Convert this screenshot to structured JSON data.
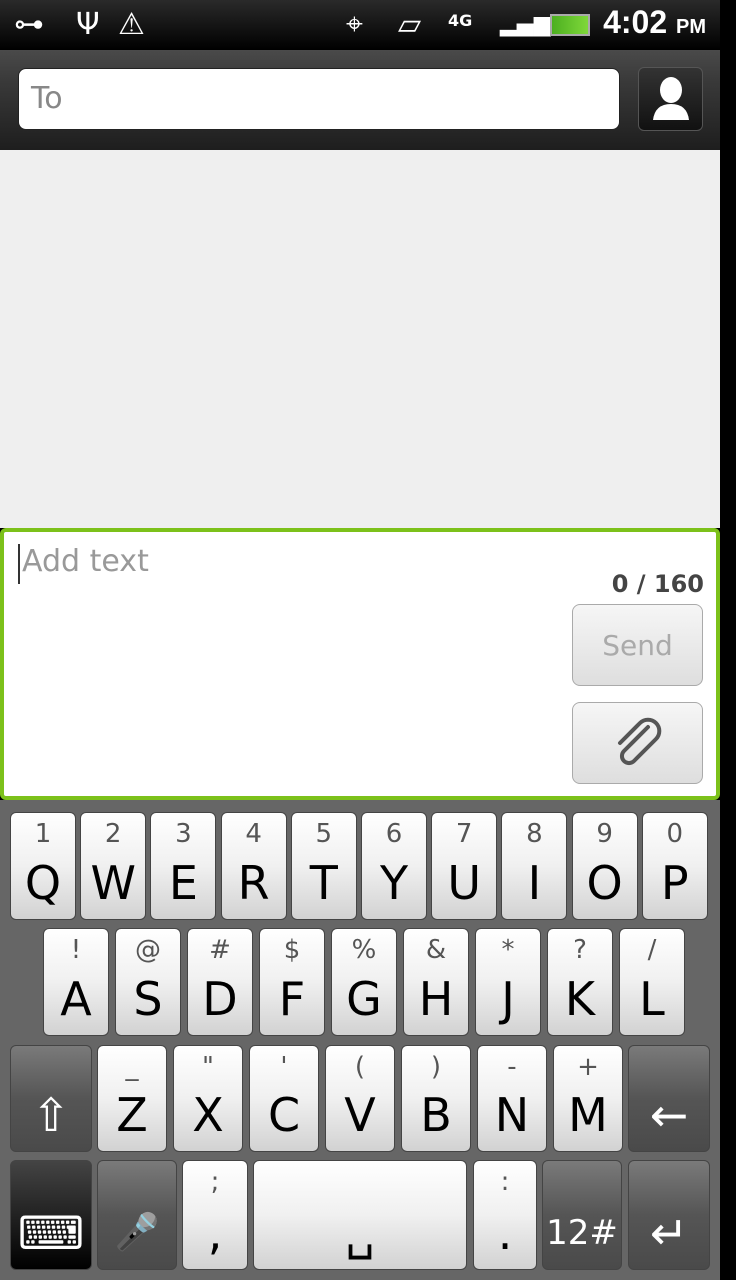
{
  "status_bar": {
    "icons": [
      "link-icon",
      "usb-icon",
      "warning-icon",
      "gps-icon",
      "vibrate-icon",
      "4g-lte-icon",
      "signal-icon",
      "battery-charging-icon"
    ],
    "network": "4G",
    "time": "4:02",
    "ampm": "PM"
  },
  "header": {
    "to_placeholder": "To",
    "contact_icon": "person-icon"
  },
  "compose": {
    "placeholder": "Add text",
    "counter": "0 / 160",
    "send_label": "Send",
    "attach_icon": "paperclip-icon",
    "accent": "#7cc11a"
  },
  "keyboard": {
    "row1": [
      [
        "1",
        "Q"
      ],
      [
        "2",
        "W"
      ],
      [
        "3",
        "E"
      ],
      [
        "4",
        "R"
      ],
      [
        "5",
        "T"
      ],
      [
        "6",
        "Y"
      ],
      [
        "7",
        "U"
      ],
      [
        "8",
        "I"
      ],
      [
        "9",
        "O"
      ],
      [
        "0",
        "P"
      ]
    ],
    "row2": [
      [
        "!",
        "A"
      ],
      [
        "@",
        "S"
      ],
      [
        "#",
        "D"
      ],
      [
        "$",
        "F"
      ],
      [
        "%",
        "G"
      ],
      [
        "&",
        "H"
      ],
      [
        "*",
        "J"
      ],
      [
        "?",
        "K"
      ],
      [
        "/",
        "L"
      ]
    ],
    "row3": [
      [
        "_",
        "Z"
      ],
      [
        "\"",
        "X"
      ],
      [
        "'",
        "C"
      ],
      [
        "(",
        "V"
      ],
      [
        ")",
        "B"
      ],
      [
        "-",
        "N"
      ],
      [
        "+",
        "M"
      ]
    ],
    "semicolon": [
      ";",
      ","
    ],
    "colon": [
      ":",
      "."
    ],
    "symbols_label": "12#",
    "space_glyph": "␣"
  }
}
